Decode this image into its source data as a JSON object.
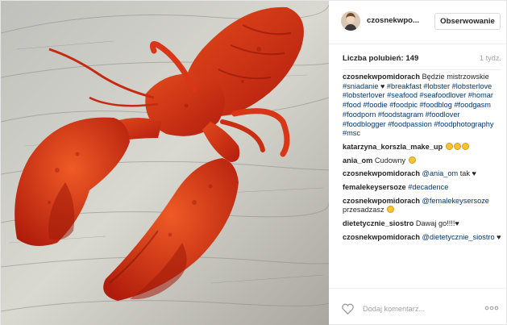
{
  "header": {
    "username": "czosnekwpo...",
    "follow_label": "Obserwowanie"
  },
  "meta": {
    "likes": "Liczba polubień: 149",
    "time": "1 tydz."
  },
  "caption": {
    "username": "czosnekwpomidorach",
    "text": "Będzie mistrzowskie",
    "hashtags": "#sniadanie",
    "hashtag_block": "#breakfast #lobster #lobsterlove #lobsterlover #seafood #seafoodlover #homar #food #foodie #foodpic #foodblog #foodgasm #foodporn #foodstagram #foodlover #foodblogger #foodpassion #foodphotography #msc"
  },
  "comments": [
    {
      "username": "katarzyna_korszla_make_up",
      "text": ""
    },
    {
      "username": "ania_om",
      "text": "Cudowny"
    },
    {
      "username": "czosnekwpomidorach",
      "mention": "@ania_om",
      "text": "tak"
    },
    {
      "username": "femalekeysersoze",
      "mention": "#decadence",
      "text": ""
    },
    {
      "username": "czosnekwpomidorach",
      "mention": "@femalekeysersoze",
      "text": "przesadzasz"
    },
    {
      "username": "dietetycznie_siostro",
      "text": "Dawaj go!!!!"
    },
    {
      "username": "czosnekwpomidorach",
      "mention": "@dietetycznie_siostro",
      "text": ""
    }
  ],
  "footer": {
    "placeholder": "Dodaj komentarz..."
  },
  "icons": {
    "like": "heart-outline-icon",
    "more": "more-options-icon"
  },
  "colors": {
    "link": "#00376b",
    "muted": "#a3a3a3",
    "border": "#dbdbdb"
  }
}
